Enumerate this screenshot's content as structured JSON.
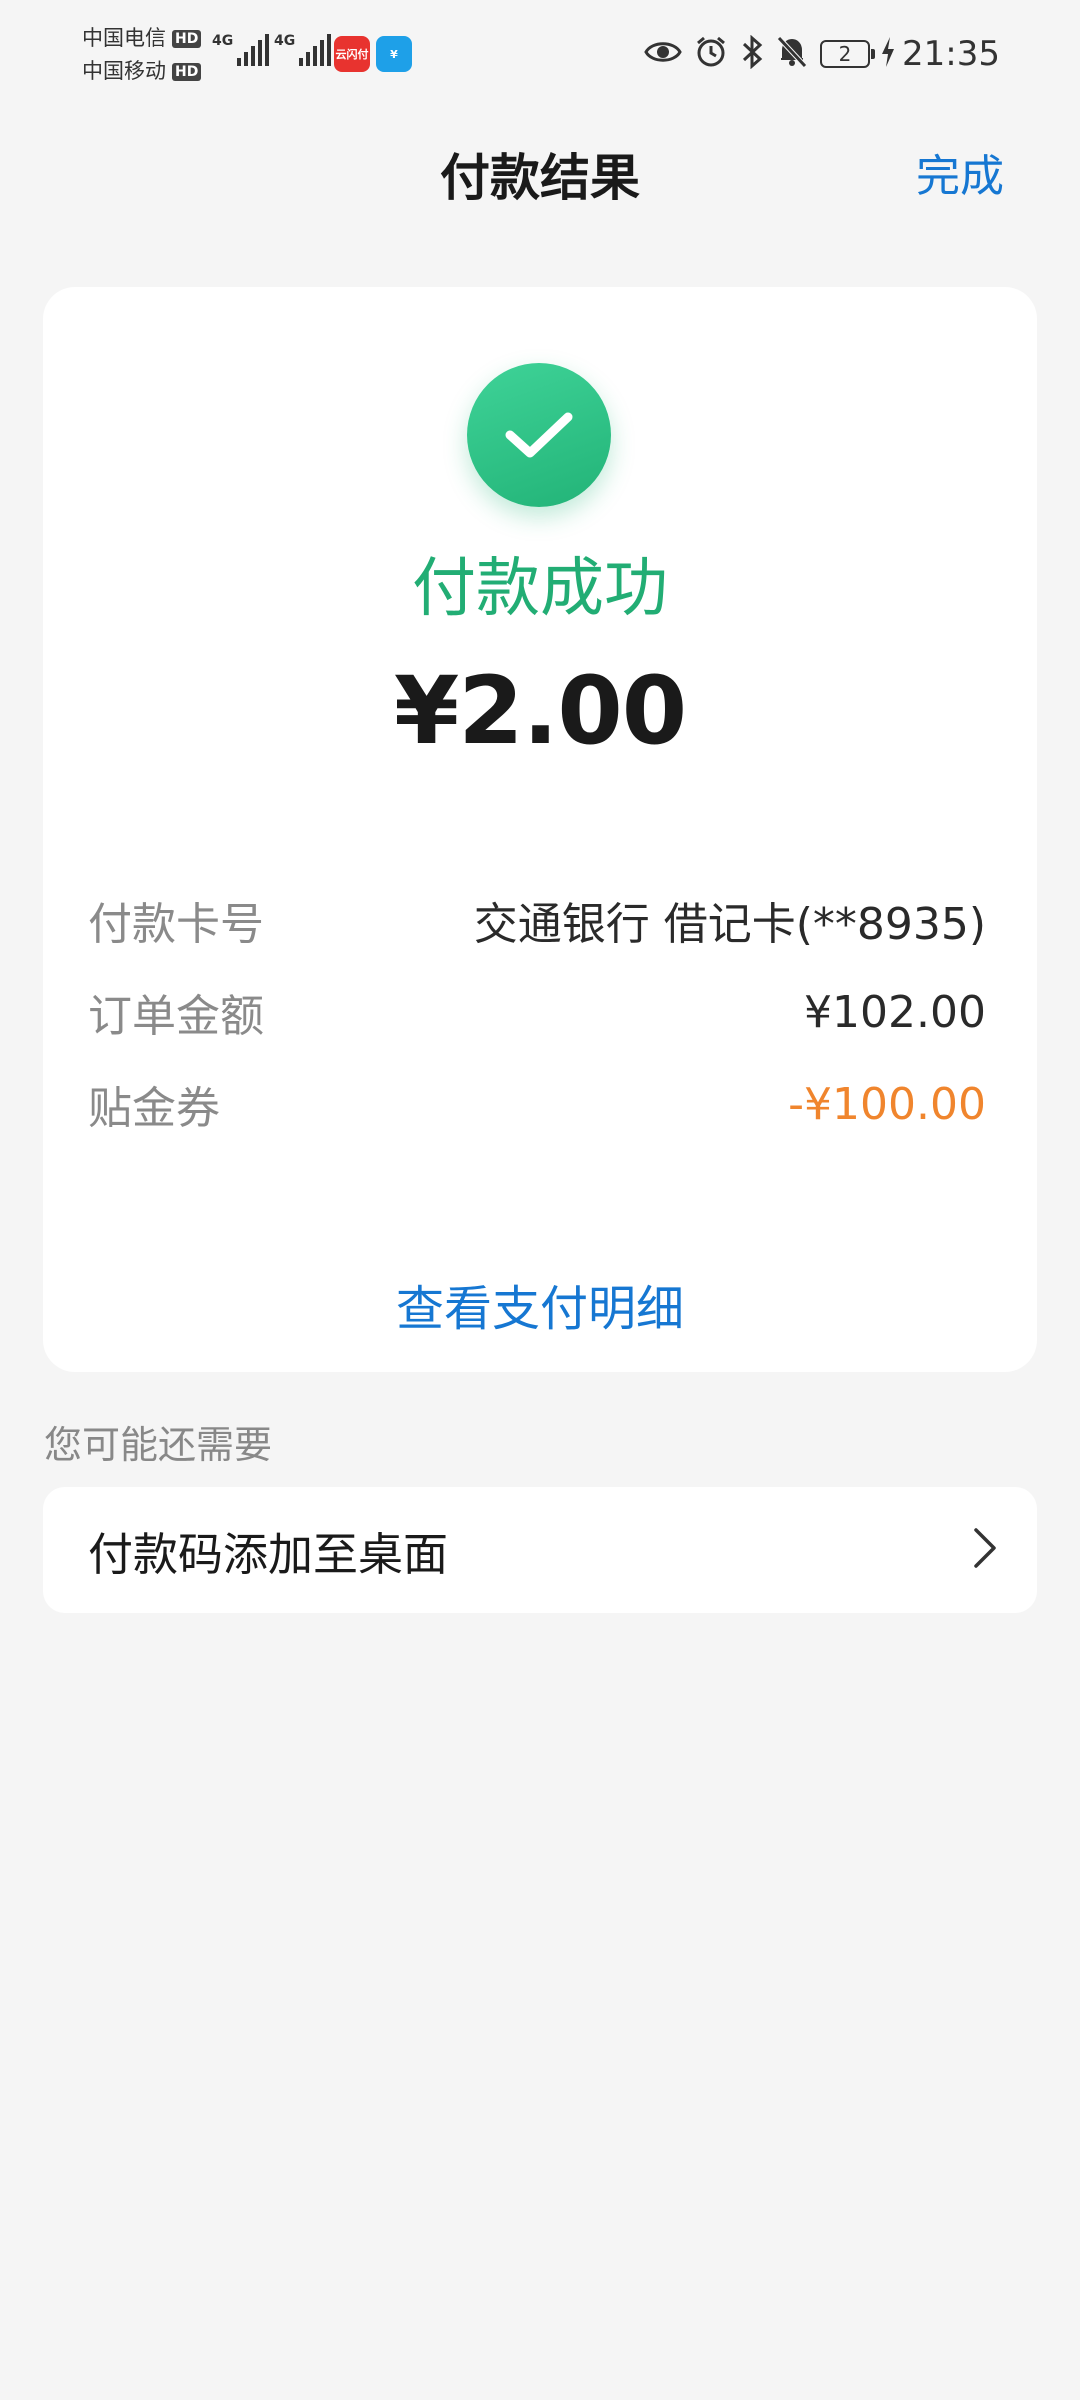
{
  "status_bar": {
    "carrier_1": "中国电信",
    "carrier_2": "中国移动",
    "hd_badge": "HD",
    "network_1": "4G",
    "network_2": "4G",
    "battery_level": "2",
    "time": "21:35",
    "app_icon_1_text": "云闪付",
    "app_icon_2_text": "¥",
    "icons": [
      "eye-icon",
      "alarm-icon",
      "bluetooth-icon",
      "mute-bell-icon",
      "battery-icon",
      "charging-icon"
    ]
  },
  "nav": {
    "title": "付款结果",
    "done_label": "完成"
  },
  "result": {
    "status": "付款成功",
    "amount": "¥2.00",
    "rows": [
      {
        "label": "付款卡号",
        "value": "交通银行 借记卡(**8935)"
      },
      {
        "label": "订单金额",
        "value": "¥102.00"
      },
      {
        "label": "贴金券",
        "value": "-¥100.00"
      }
    ],
    "detail_link": "查看支付明细"
  },
  "suggestions": {
    "section_title": "您可能还需要",
    "items": [
      {
        "label": "付款码添加至桌面"
      }
    ]
  },
  "colors": {
    "success_green": "#22ad74",
    "link_blue": "#1677d2",
    "discount_orange": "#f0852d",
    "background": "#f5f5f5"
  }
}
